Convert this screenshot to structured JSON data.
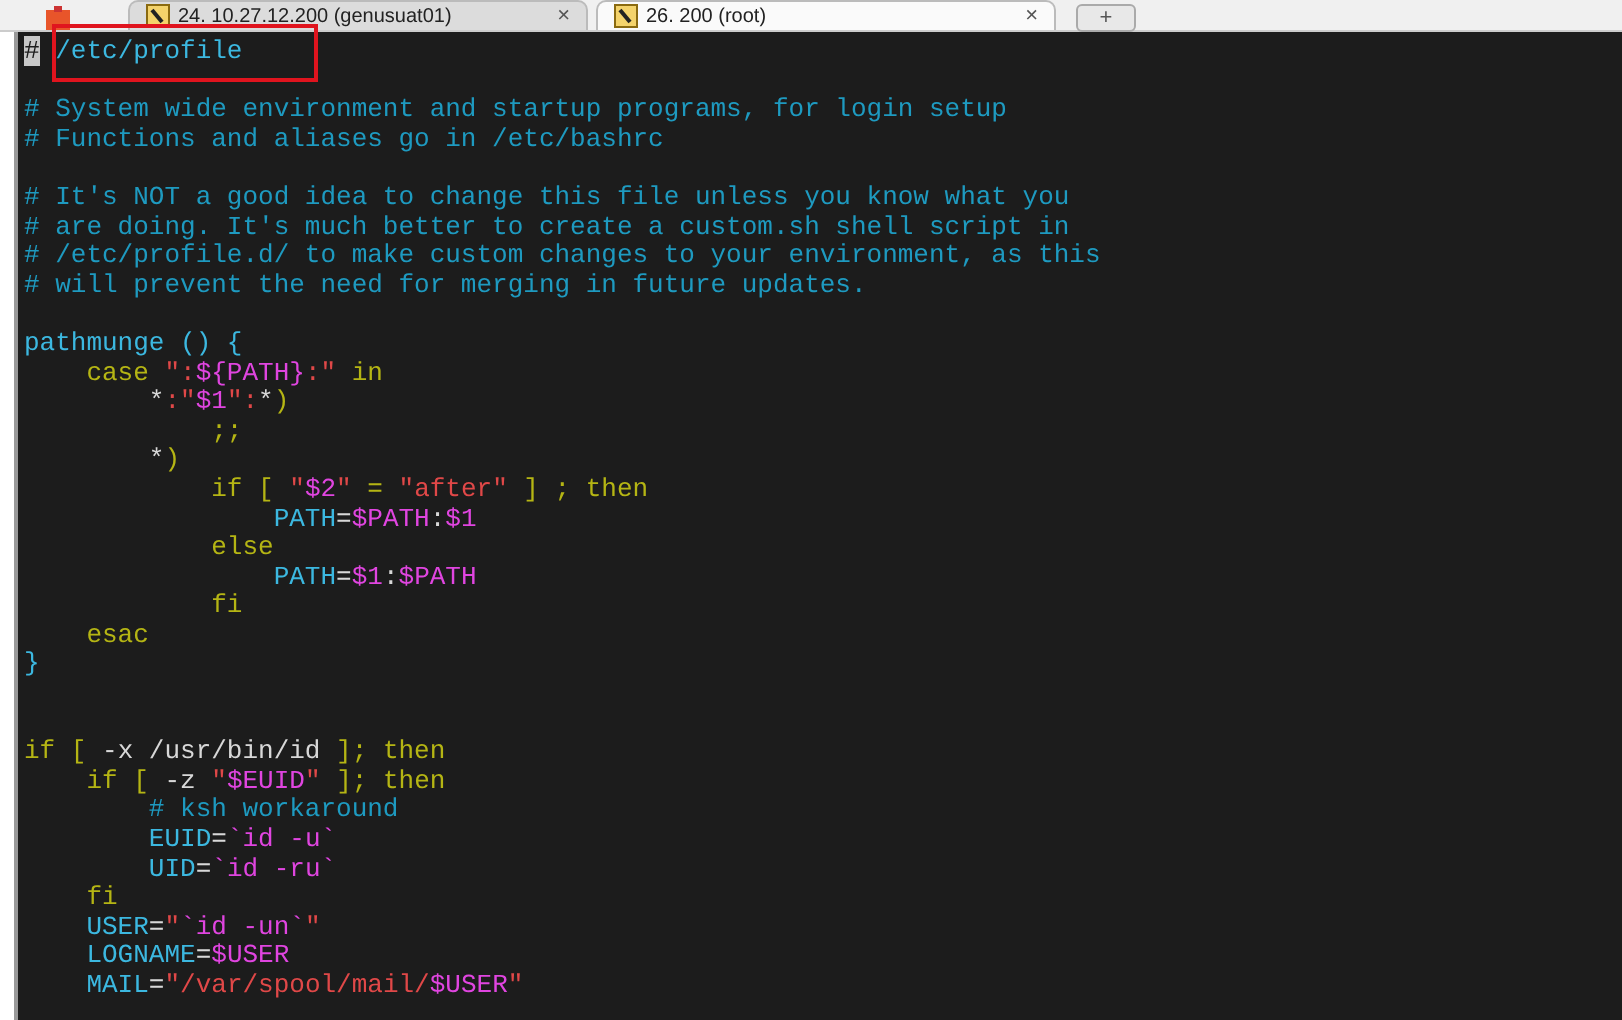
{
  "tabs": [
    {
      "label": "24. 10.27.12.200 (genusuat01)",
      "close": "×",
      "selected": false
    },
    {
      "label": "26. 200 (root)",
      "close": "×",
      "selected": true
    }
  ],
  "new_tab": "+",
  "lines": [
    {
      "kind": "code",
      "segments": [
        {
          "kind": "cursor",
          "text": "#"
        },
        {
          "kind": "boxed",
          "text": "/etc/profile"
        }
      ]
    },
    {
      "kind": "blank"
    },
    {
      "kind": "code",
      "segments": [
        {
          "kind": "comment",
          "text": "# System wide environment and startup programs, for login setup"
        }
      ]
    },
    {
      "kind": "code",
      "segments": [
        {
          "kind": "comment",
          "text": "# Functions and aliases go in /etc/bashrc"
        }
      ]
    },
    {
      "kind": "blank"
    },
    {
      "kind": "code",
      "segments": [
        {
          "kind": "comment",
          "text": "# It's NOT a good idea to change this file unless you know what you"
        }
      ]
    },
    {
      "kind": "code",
      "segments": [
        {
          "kind": "comment",
          "text": "# are doing. It's much better to create a custom.sh shell script in"
        }
      ]
    },
    {
      "kind": "code",
      "segments": [
        {
          "kind": "comment",
          "text": "# /etc/profile.d/ to make custom changes to your environment, as this"
        }
      ]
    },
    {
      "kind": "code",
      "segments": [
        {
          "kind": "comment",
          "text": "# will prevent the need for merging in future updates."
        }
      ]
    },
    {
      "kind": "blank"
    },
    {
      "kind": "code",
      "segments": [
        {
          "kind": "ident",
          "text": "pathmunge () {"
        }
      ]
    },
    {
      "kind": "code",
      "segments": [
        {
          "kind": "keyword",
          "text": "    case "
        },
        {
          "kind": "string",
          "text": "\":"
        },
        {
          "kind": "variable",
          "text": "${PATH}"
        },
        {
          "kind": "string",
          "text": ":\""
        },
        {
          "kind": "keyword",
          "text": " in"
        }
      ]
    },
    {
      "kind": "code",
      "segments": [
        {
          "kind": "plain",
          "text": "        *"
        },
        {
          "kind": "string",
          "text": ":\""
        },
        {
          "kind": "variable",
          "text": "$1"
        },
        {
          "kind": "string",
          "text": "\":"
        },
        {
          "kind": "plain",
          "text": "*"
        },
        {
          "kind": "keyword",
          "text": ")"
        }
      ]
    },
    {
      "kind": "code",
      "segments": [
        {
          "kind": "keyword",
          "text": "            ;;"
        }
      ]
    },
    {
      "kind": "code",
      "segments": [
        {
          "kind": "plain",
          "text": "        *"
        },
        {
          "kind": "keyword",
          "text": ")"
        }
      ]
    },
    {
      "kind": "code",
      "segments": [
        {
          "kind": "keyword",
          "text": "            if [ "
        },
        {
          "kind": "string",
          "text": "\""
        },
        {
          "kind": "variable",
          "text": "$2"
        },
        {
          "kind": "string",
          "text": "\""
        },
        {
          "kind": "keyword",
          "text": " = "
        },
        {
          "kind": "string",
          "text": "\"after\""
        },
        {
          "kind": "keyword",
          "text": " ] ; then"
        }
      ]
    },
    {
      "kind": "code",
      "segments": [
        {
          "kind": "ident",
          "text": "                PATH"
        },
        {
          "kind": "plain",
          "text": "="
        },
        {
          "kind": "variable",
          "text": "$PATH"
        },
        {
          "kind": "plain",
          "text": ":"
        },
        {
          "kind": "variable",
          "text": "$1"
        }
      ]
    },
    {
      "kind": "code",
      "segments": [
        {
          "kind": "keyword",
          "text": "            else"
        }
      ]
    },
    {
      "kind": "code",
      "segments": [
        {
          "kind": "ident",
          "text": "                PATH"
        },
        {
          "kind": "plain",
          "text": "="
        },
        {
          "kind": "variable",
          "text": "$1"
        },
        {
          "kind": "plain",
          "text": ":"
        },
        {
          "kind": "variable",
          "text": "$PATH"
        }
      ]
    },
    {
      "kind": "code",
      "segments": [
        {
          "kind": "keyword",
          "text": "            fi"
        }
      ]
    },
    {
      "kind": "code",
      "segments": [
        {
          "kind": "keyword",
          "text": "    esac"
        }
      ]
    },
    {
      "kind": "code",
      "segments": [
        {
          "kind": "ident",
          "text": "}"
        }
      ]
    },
    {
      "kind": "blank"
    },
    {
      "kind": "blank"
    },
    {
      "kind": "code",
      "segments": [
        {
          "kind": "keyword",
          "text": "if [ "
        },
        {
          "kind": "plain",
          "text": "-x /usr/bin/id"
        },
        {
          "kind": "keyword",
          "text": " ]; then"
        }
      ]
    },
    {
      "kind": "code",
      "segments": [
        {
          "kind": "keyword",
          "text": "    if [ "
        },
        {
          "kind": "plain",
          "text": "-z "
        },
        {
          "kind": "string",
          "text": "\""
        },
        {
          "kind": "variable",
          "text": "$EUID"
        },
        {
          "kind": "string",
          "text": "\""
        },
        {
          "kind": "keyword",
          "text": " ]; then"
        }
      ]
    },
    {
      "kind": "code",
      "segments": [
        {
          "kind": "comment",
          "text": "        # ksh workaround"
        }
      ]
    },
    {
      "kind": "code",
      "segments": [
        {
          "kind": "ident",
          "text": "        EUID"
        },
        {
          "kind": "plain",
          "text": "="
        },
        {
          "kind": "variable",
          "text": "`id -u`"
        }
      ]
    },
    {
      "kind": "code",
      "segments": [
        {
          "kind": "ident",
          "text": "        UID"
        },
        {
          "kind": "plain",
          "text": "="
        },
        {
          "kind": "variable",
          "text": "`id -ru`"
        }
      ]
    },
    {
      "kind": "code",
      "segments": [
        {
          "kind": "keyword",
          "text": "    fi"
        }
      ]
    },
    {
      "kind": "code",
      "segments": [
        {
          "kind": "ident",
          "text": "    USER"
        },
        {
          "kind": "plain",
          "text": "="
        },
        {
          "kind": "string",
          "text": "\""
        },
        {
          "kind": "variable",
          "text": "`id -un`"
        },
        {
          "kind": "string",
          "text": "\""
        }
      ]
    },
    {
      "kind": "code",
      "segments": [
        {
          "kind": "ident",
          "text": "    LOGNAME"
        },
        {
          "kind": "plain",
          "text": "="
        },
        {
          "kind": "variable",
          "text": "$USER"
        }
      ]
    },
    {
      "kind": "code",
      "segments": [
        {
          "kind": "ident",
          "text": "    MAIL"
        },
        {
          "kind": "plain",
          "text": "="
        },
        {
          "kind": "string",
          "text": "\"/var/spool/mail/"
        },
        {
          "kind": "variable",
          "text": "$USER"
        },
        {
          "kind": "string",
          "text": "\""
        }
      ]
    }
  ]
}
